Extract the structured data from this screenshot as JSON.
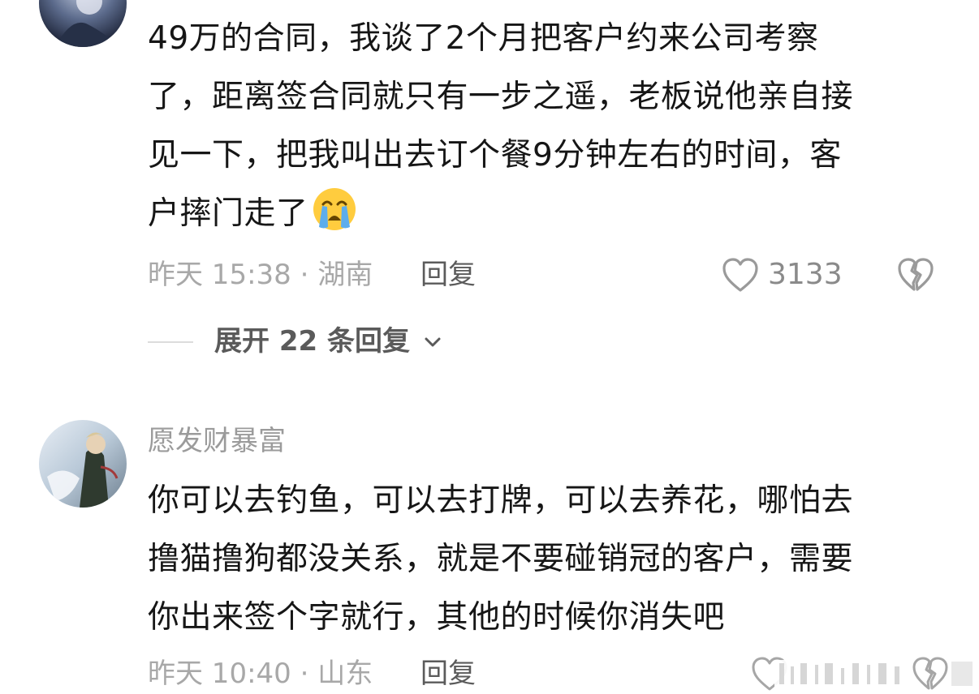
{
  "comments": [
    {
      "username": "",
      "lines": [
        "49万的合同，我谈了2个月把客户约来公司考察",
        "了，距离签合同就只有一步之遥，老板说他亲自接",
        "见一下，把我叫出去订个餐9分钟左右的时间，客",
        "户摔门走了"
      ],
      "emoji": "loudly-crying-face-icon",
      "time_location": "昨天 15:38 · 湖南",
      "reply_label": "回复",
      "like_count": "3133",
      "expand_label": "展开 22 条回复"
    },
    {
      "username": "愿发财暴富",
      "lines": [
        "你可以去钓鱼，可以去打牌，可以去养花，哪怕去",
        "撸猫撸狗都没关系，就是不要碰销冠的客户，需要",
        "你出来签个字就行，其他的时候你消失吧"
      ],
      "time_location": "昨天 10:40 · 山东",
      "reply_label": "回复"
    }
  ],
  "colors": {
    "text": "#161616",
    "meta": "#a8a8a8",
    "username": "#9b9b9b",
    "reply": "#5b5b5b"
  }
}
